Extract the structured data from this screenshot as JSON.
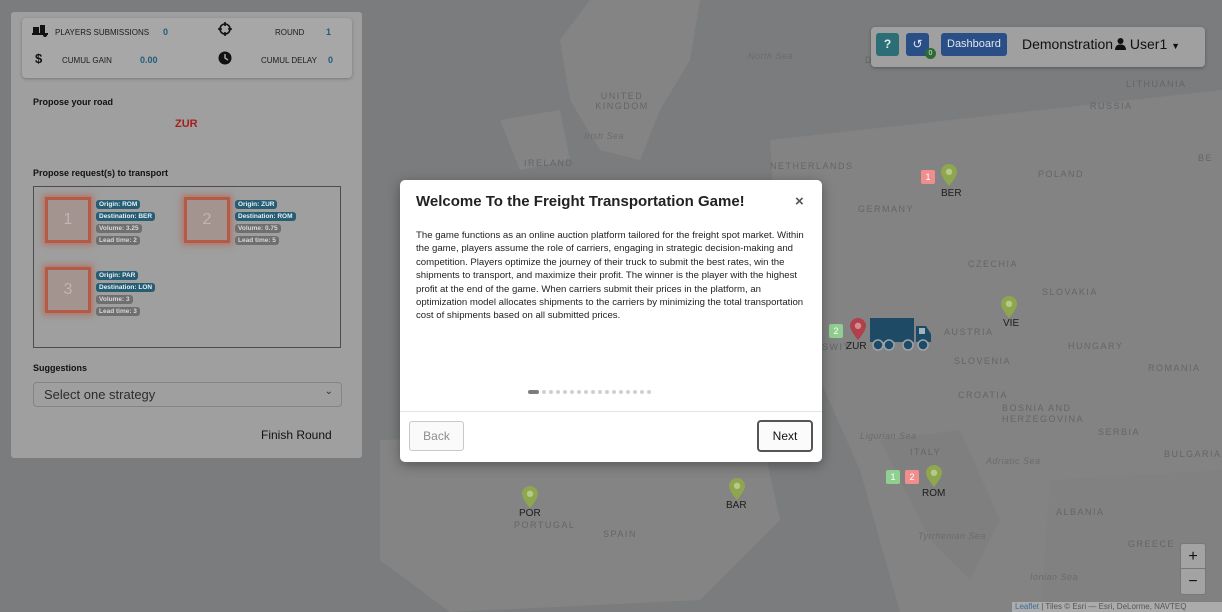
{
  "stats": {
    "submissions_label": "PLAYERS SUBMISSIONS",
    "submissions_value": "0",
    "round_label": "ROUND",
    "round_value": "1",
    "gain_label": "CUMUL GAIN",
    "gain_value": "0.00",
    "delay_label": "CUMUL DELAY",
    "delay_value": "0",
    "icons": {
      "submissions": "truck-loading-icon",
      "round": "crosshairs-icon",
      "gain": "dollar-icon",
      "delay": "clock-icon"
    }
  },
  "road": {
    "title": "Propose your road",
    "value": "ZUR"
  },
  "requests": {
    "title": "Propose request(s) to transport",
    "items": [
      {
        "number": "1",
        "origin": "Origin: ROM",
        "destination": "Destination: BER",
        "volume": "Volume: 3.25",
        "lead_time": "Lead time: 2"
      },
      {
        "number": "2",
        "origin": "Origin: ZUR",
        "destination": "Destination: ROM",
        "volume": "Volume: 0.75",
        "lead_time": "Lead time: 5"
      },
      {
        "number": "3",
        "origin": "Origin: PAR",
        "destination": "Destination: LON",
        "volume": "Volume: 3",
        "lead_time": "Lead time: 3"
      }
    ]
  },
  "suggestions": {
    "title": "Suggestions",
    "placeholder": "Select one strategy"
  },
  "finish_round": "Finish Round",
  "nav": {
    "help": "?",
    "history_badge": "0",
    "dashboard": "Dashboard",
    "title": "Demonstration",
    "user": "User1"
  },
  "map": {
    "labels": {
      "north_sea": "North Sea",
      "uk": "UNITED KINGDOM",
      "irish_sea": "Irish Sea",
      "ireland": "IRELAND",
      "netherlands": "NETHERLANDS",
      "germany": "GERMANY",
      "poland": "POLAND",
      "lithuania": "LITHUANIA",
      "russia": "RUSSIA",
      "czechia": "CZECHIA",
      "slovakia": "SLOVAKIA",
      "austria": "AUSTRIA",
      "hungary": "HUNGARY",
      "slovenia": "SLOVENIA",
      "romania": "ROMANIA",
      "croatia": "CROATIA",
      "bosnia": "BOSNIA AND HERZEGOVINA",
      "serbia": "SERBIA",
      "bulgaria": "BULGARIA",
      "italy": "ITALY",
      "adriatic": "Adriatic Sea",
      "ligurian": "Ligurian Sea",
      "albania": "ALBANIA",
      "greece": "GREECE",
      "tyrrhenian": "Tyrrhenian Sea",
      "ionian": "Ionian Sea",
      "spain": "SPAIN",
      "portugal": "PORTUGAL",
      "switz": "SWIT",
      "d": "D",
      "be": "BE"
    },
    "cities": {
      "ber": "BER",
      "vie": "VIE",
      "zur": "ZUR",
      "rom": "ROM",
      "bar": "BAR",
      "por": "POR"
    },
    "badges": {
      "ber_1": "1",
      "zur_2": "2",
      "rom_1": "1",
      "rom_2": "2"
    },
    "zoom_in": "+",
    "zoom_out": "−",
    "attribution_link": "Leaflet",
    "attribution_text": " | Tiles © Esri — Esri, DeLorme, NAVTEQ"
  },
  "modal": {
    "title": "Welcome To the Freight Transportation Game!",
    "close": "×",
    "body": "The game functions as an online auction platform tailored for the freight spot market. Within the game, players assume the role of carriers, engaging in strategic decision-making and competition. Players optimize the journey of their truck to submit the best rates, win the shipments to transport, and maximize their profit. The winner is the player with the highest profit at the end of the game. When carriers submit their prices in the platform, an optimization model allocates shipments to the carriers by minimizing the total transportation cost of shipments based on all submitted prices.",
    "step_current": 1,
    "step_total": 17,
    "back": "Back",
    "next": "Next"
  }
}
